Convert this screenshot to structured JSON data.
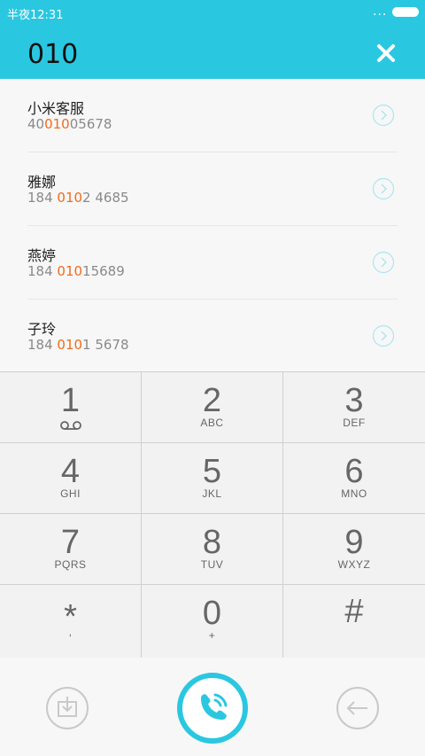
{
  "status": {
    "time": "半夜12:31",
    "menu": "..."
  },
  "header": {
    "dialed_number": "010"
  },
  "results": [
    {
      "name": "小米客服",
      "number_parts": [
        "40",
        "010",
        "05678"
      ]
    },
    {
      "name": "雅娜",
      "number_parts": [
        "184 ",
        "010",
        "2 4685"
      ]
    },
    {
      "name": "燕婷",
      "number_parts": [
        "184 ",
        "010",
        "15689"
      ]
    },
    {
      "name": "子玲",
      "number_parts": [
        "184 ",
        "010",
        "1 5678"
      ]
    }
  ],
  "keypad": [
    {
      "digit": "1",
      "letters": ""
    },
    {
      "digit": "2",
      "letters": "ABC"
    },
    {
      "digit": "3",
      "letters": "DEF"
    },
    {
      "digit": "4",
      "letters": "GHI"
    },
    {
      "digit": "5",
      "letters": "JKL"
    },
    {
      "digit": "6",
      "letters": "MNO"
    },
    {
      "digit": "7",
      "letters": "PQRS"
    },
    {
      "digit": "8",
      "letters": "TUV"
    },
    {
      "digit": "9",
      "letters": "WXYZ"
    },
    {
      "digit": "*",
      "letters": ","
    },
    {
      "digit": "0",
      "letters": "+"
    },
    {
      "digit": "#",
      "letters": ""
    }
  ],
  "colors": {
    "accent": "#2ac7e1",
    "highlight": "#f26a1b"
  },
  "icons": {
    "close": "close-icon",
    "chevron": "chevron-right-circle-icon",
    "voicemail": "voicemail-icon",
    "save": "save-contact-icon",
    "call": "phone-call-icon",
    "backspace": "backspace-arrow-icon"
  }
}
